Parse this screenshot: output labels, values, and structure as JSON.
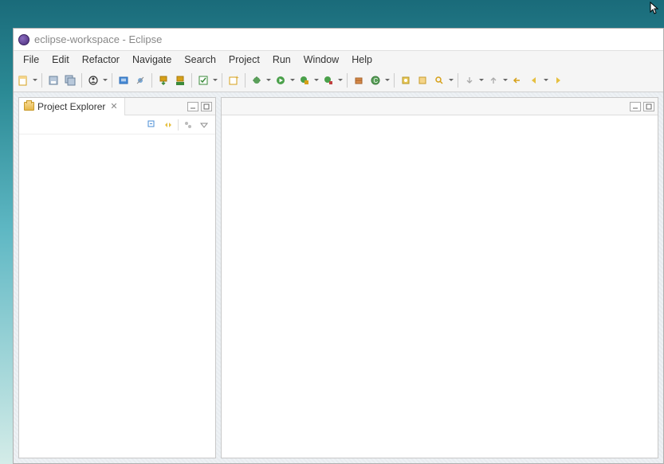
{
  "window": {
    "title": "eclipse-workspace - Eclipse"
  },
  "menu": {
    "file": "File",
    "edit": "Edit",
    "refactor": "Refactor",
    "navigate": "Navigate",
    "search": "Search",
    "project": "Project",
    "run": "Run",
    "window": "Window",
    "help": "Help"
  },
  "explorer": {
    "title": "Project Explorer"
  },
  "toolbar_icons": {
    "new": "new-icon",
    "save": "save-icon",
    "save_all": "save-all-icon",
    "annotation": "annotation-icon",
    "build": "build-icon",
    "toggle_mark": "toggle-mark-icon",
    "debug": "debug-icon",
    "run": "run-icon",
    "coverage": "coverage-icon",
    "run_last": "run-last-icon",
    "new_package": "new-package-icon",
    "new_class": "new-class-icon",
    "open_type": "open-type-icon",
    "search": "search-icon",
    "task": "task-icon",
    "back": "back-icon",
    "forward": "forward-icon"
  }
}
